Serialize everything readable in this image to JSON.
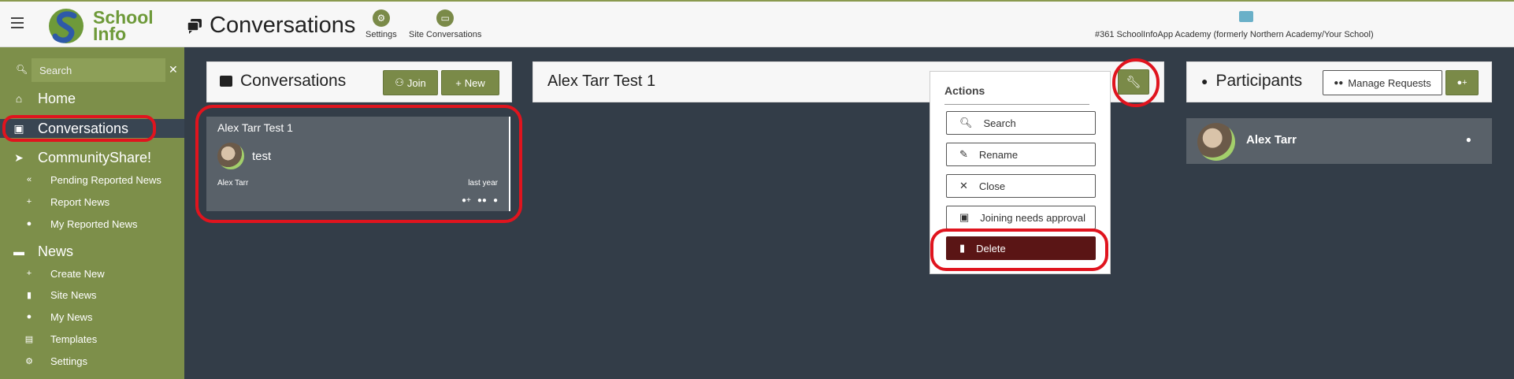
{
  "topbar": {
    "logo": {
      "line1": "School",
      "line2": "Info"
    },
    "page_title": "Conversations",
    "actions": [
      {
        "label": "Settings",
        "icon": "gear-icon"
      },
      {
        "label": "Site Conversations",
        "icon": "chat-icon"
      }
    ],
    "school_name": "#361 SchoolInfoApp Academy (formerly Northern Academy/Your School)"
  },
  "sidebar": {
    "search": {
      "placeholder": "Search",
      "value": ""
    },
    "items": [
      {
        "label": "Home",
        "icon": "home-icon",
        "type": "main"
      },
      {
        "label": "Conversations",
        "icon": "chat-icon",
        "type": "main",
        "active": true
      },
      {
        "label": "CommunityShare!",
        "icon": "paper-plane-icon",
        "type": "main"
      },
      {
        "label": "Pending Reported News",
        "icon": "reply-all-icon",
        "type": "sub"
      },
      {
        "label": "Report News",
        "icon": "plus-icon",
        "type": "sub"
      },
      {
        "label": "My Reported News",
        "icon": "user-icon",
        "type": "sub"
      },
      {
        "label": "News",
        "icon": "comment-icon",
        "type": "main"
      },
      {
        "label": "Create New",
        "icon": "plus-icon",
        "type": "sub"
      },
      {
        "label": "Site News",
        "icon": "book-icon",
        "type": "sub"
      },
      {
        "label": "My News",
        "icon": "user-icon",
        "type": "sub"
      },
      {
        "label": "Templates",
        "icon": "template-icon",
        "type": "sub"
      },
      {
        "label": "Settings",
        "icon": "gear-icon",
        "type": "sub"
      }
    ]
  },
  "conversations_panel": {
    "title": "Conversations",
    "join_label": "Join",
    "new_label": "New",
    "card": {
      "title": "Alex Tarr Test 1",
      "last_message": "test",
      "author": "Alex Tarr",
      "time": "last year"
    }
  },
  "detail_panel": {
    "title": "Alex Tarr Test 1"
  },
  "actions_menu": {
    "header": "Actions",
    "items": [
      {
        "label": "Search",
        "icon": "search-icon"
      },
      {
        "label": "Rename",
        "icon": "pencil-icon"
      },
      {
        "label": "Close",
        "icon": "close-icon"
      },
      {
        "label": "Joining needs approval",
        "icon": "lock-icon"
      },
      {
        "label": "Delete",
        "icon": "trash-icon"
      }
    ]
  },
  "participants_panel": {
    "title": "Participants",
    "manage_label": "Manage Requests",
    "participant": {
      "name": "Alex Tarr"
    }
  },
  "colors": {
    "accent": "#7a8a48",
    "sidebar": "#7d8f4a",
    "background": "#333d48",
    "delete": "#5a1515",
    "highlight": "#e0141e"
  }
}
